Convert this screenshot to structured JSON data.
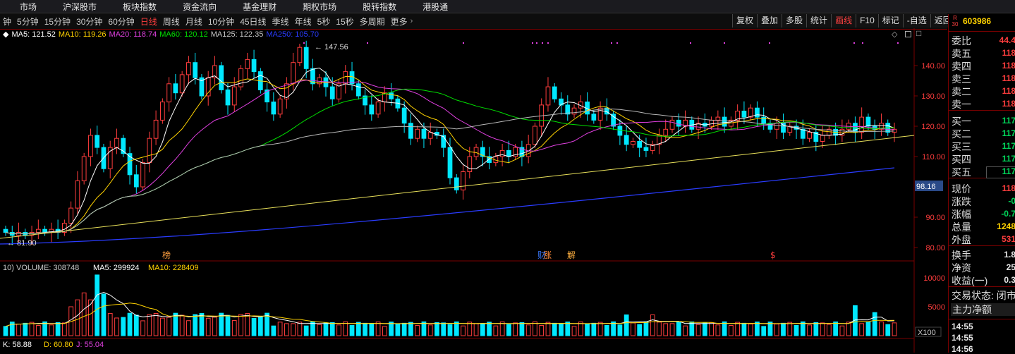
{
  "topbar": [
    "市场",
    "沪深股市",
    "板块指数",
    "资金流向",
    "基金理财",
    "期权市场",
    "股转指数",
    "港股通"
  ],
  "periods": [
    {
      "label": "钟",
      "active": false
    },
    {
      "label": "5分钟",
      "active": false
    },
    {
      "label": "15分钟",
      "active": false
    },
    {
      "label": "30分钟",
      "active": false
    },
    {
      "label": "60分钟",
      "active": false
    },
    {
      "label": "日线",
      "active": true
    },
    {
      "label": "周线",
      "active": false
    },
    {
      "label": "月线",
      "active": false
    },
    {
      "label": "10分钟",
      "active": false
    },
    {
      "label": "45日线",
      "active": false
    },
    {
      "label": "季线",
      "active": false
    },
    {
      "label": "年线",
      "active": false
    },
    {
      "label": "5秒",
      "active": false
    },
    {
      "label": "15秒",
      "active": false
    },
    {
      "label": "多周期",
      "active": false
    },
    {
      "label": "更多",
      "active": false
    }
  ],
  "period_more_icon": "chevron-right-icon",
  "tools": [
    {
      "label": "复权",
      "active": false
    },
    {
      "label": "叠加",
      "active": false
    },
    {
      "label": "多股",
      "active": false
    },
    {
      "label": "统计",
      "active": false
    },
    {
      "label": "画线",
      "active": true
    },
    {
      "label": "F10",
      "active": false
    },
    {
      "label": "标记",
      "active": false
    },
    {
      "label": "-自选",
      "active": false
    },
    {
      "label": "返回",
      "active": false
    }
  ],
  "ma_legend": [
    {
      "text": "MA5: 121.52",
      "color": "#ffffff"
    },
    {
      "text": "MA10: 119.26",
      "color": "#ffd200"
    },
    {
      "text": "MA20: 118.74",
      "color": "#e040e0"
    },
    {
      "text": "MA60: 120.12",
      "color": "#00e000"
    },
    {
      "text": "MA125: 122.35",
      "color": "#c8c8c8"
    },
    {
      "text": "MA250: 105.70",
      "color": "#2a3cff"
    }
  ],
  "vol_legend": [
    {
      "text": "10) VOLUME: 308748",
      "color": "#c8c8c8"
    },
    {
      "text": "MA5: 299924",
      "color": "#ffffff"
    },
    {
      "text": "MA10: 228409",
      "color": "#ffd200"
    }
  ],
  "ind_legend": [
    {
      "text": "K: 58.88",
      "color": "#ffffff"
    },
    {
      "text": "D: 60.80",
      "color": "#ffd200"
    },
    {
      "text": "J: 55.04",
      "color": "#e040e0"
    }
  ],
  "chart_data": {
    "type": "candlestick",
    "price_axis": {
      "ticks": [
        "140.00",
        "130.00",
        "120.00",
        "110.00",
        "90.00",
        "80.00"
      ],
      "range": [
        78,
        149
      ]
    },
    "current_price_tag": "98.16",
    "high_label": "147.56",
    "low_label": "81.90",
    "volume_axis": {
      "ticks": [
        "10000",
        "5000"
      ],
      "unit": "X100"
    },
    "event_markers": [
      "榜",
      "财",
      "涨",
      "解",
      "$"
    ],
    "candles_approx": [
      {
        "o": 86,
        "c": 85
      },
      {
        "o": 85,
        "c": 84
      },
      {
        "o": 84,
        "c": 85
      },
      {
        "o": 85,
        "c": 84
      },
      {
        "o": 84,
        "c": 85
      },
      {
        "o": 85,
        "c": 86
      },
      {
        "o": 86,
        "c": 85
      },
      {
        "o": 85,
        "c": 86
      },
      {
        "o": 86,
        "c": 85
      },
      {
        "o": 85,
        "c": 88
      },
      {
        "o": 88,
        "c": 93
      },
      {
        "o": 93,
        "c": 102
      },
      {
        "o": 102,
        "c": 110
      },
      {
        "o": 110,
        "c": 117
      },
      {
        "o": 117,
        "c": 113
      },
      {
        "o": 113,
        "c": 106
      },
      {
        "o": 106,
        "c": 113
      },
      {
        "o": 113,
        "c": 116
      },
      {
        "o": 116,
        "c": 111
      },
      {
        "o": 111,
        "c": 104
      },
      {
        "o": 104,
        "c": 100
      },
      {
        "o": 100,
        "c": 108
      },
      {
        "o": 108,
        "c": 116
      },
      {
        "o": 116,
        "c": 122
      },
      {
        "o": 122,
        "c": 128
      },
      {
        "o": 128,
        "c": 134
      },
      {
        "o": 134,
        "c": 131
      },
      {
        "o": 131,
        "c": 137
      },
      {
        "o": 137,
        "c": 141
      },
      {
        "o": 141,
        "c": 136
      },
      {
        "o": 136,
        "c": 130
      },
      {
        "o": 130,
        "c": 136
      },
      {
        "o": 136,
        "c": 140
      },
      {
        "o": 140,
        "c": 132
      },
      {
        "o": 132,
        "c": 127
      },
      {
        "o": 127,
        "c": 133
      },
      {
        "o": 133,
        "c": 139
      },
      {
        "o": 139,
        "c": 142
      },
      {
        "o": 142,
        "c": 138
      },
      {
        "o": 138,
        "c": 132
      },
      {
        "o": 132,
        "c": 128
      },
      {
        "o": 128,
        "c": 124
      },
      {
        "o": 124,
        "c": 129
      },
      {
        "o": 129,
        "c": 134
      },
      {
        "o": 134,
        "c": 141
      },
      {
        "o": 141,
        "c": 146
      },
      {
        "o": 146,
        "c": 139
      },
      {
        "o": 139,
        "c": 134
      },
      {
        "o": 134,
        "c": 136
      },
      {
        "o": 136,
        "c": 133
      },
      {
        "o": 133,
        "c": 129
      },
      {
        "o": 129,
        "c": 134
      },
      {
        "o": 134,
        "c": 138
      },
      {
        "o": 138,
        "c": 134
      },
      {
        "o": 134,
        "c": 130
      },
      {
        "o": 130,
        "c": 127
      },
      {
        "o": 127,
        "c": 124
      },
      {
        "o": 124,
        "c": 128
      },
      {
        "o": 128,
        "c": 131
      },
      {
        "o": 131,
        "c": 129
      },
      {
        "o": 129,
        "c": 126
      },
      {
        "o": 126,
        "c": 121
      },
      {
        "o": 121,
        "c": 116
      },
      {
        "o": 116,
        "c": 119
      },
      {
        "o": 119,
        "c": 116
      },
      {
        "o": 116,
        "c": 118
      },
      {
        "o": 118,
        "c": 117
      },
      {
        "o": 117,
        "c": 113
      },
      {
        "o": 113,
        "c": 103
      },
      {
        "o": 103,
        "c": 99
      },
      {
        "o": 99,
        "c": 105
      },
      {
        "o": 105,
        "c": 110
      },
      {
        "o": 110,
        "c": 113
      },
      {
        "o": 113,
        "c": 110
      },
      {
        "o": 110,
        "c": 108
      },
      {
        "o": 108,
        "c": 110
      },
      {
        "o": 110,
        "c": 112
      },
      {
        "o": 112,
        "c": 110
      },
      {
        "o": 110,
        "c": 113
      },
      {
        "o": 113,
        "c": 110
      },
      {
        "o": 110,
        "c": 114
      },
      {
        "o": 114,
        "c": 120
      },
      {
        "o": 120,
        "c": 127
      },
      {
        "o": 127,
        "c": 133
      },
      {
        "o": 133,
        "c": 129
      },
      {
        "o": 129,
        "c": 127
      },
      {
        "o": 127,
        "c": 124
      },
      {
        "o": 124,
        "c": 126
      },
      {
        "o": 126,
        "c": 128
      },
      {
        "o": 128,
        "c": 124
      },
      {
        "o": 124,
        "c": 122
      },
      {
        "o": 122,
        "c": 126
      },
      {
        "o": 126,
        "c": 124
      },
      {
        "o": 124,
        "c": 120
      },
      {
        "o": 120,
        "c": 117
      },
      {
        "o": 117,
        "c": 114
      },
      {
        "o": 114,
        "c": 115
      },
      {
        "o": 115,
        "c": 113
      },
      {
        "o": 113,
        "c": 112
      },
      {
        "o": 112,
        "c": 114
      },
      {
        "o": 114,
        "c": 117
      },
      {
        "o": 117,
        "c": 119
      },
      {
        "o": 119,
        "c": 122
      },
      {
        "o": 122,
        "c": 120
      },
      {
        "o": 120,
        "c": 122
      },
      {
        "o": 122,
        "c": 119
      },
      {
        "o": 119,
        "c": 121
      },
      {
        "o": 121,
        "c": 120
      },
      {
        "o": 120,
        "c": 122
      },
      {
        "o": 122,
        "c": 123
      },
      {
        "o": 123,
        "c": 120
      },
      {
        "o": 120,
        "c": 122
      },
      {
        "o": 122,
        "c": 125
      },
      {
        "o": 125,
        "c": 123
      },
      {
        "o": 123,
        "c": 126
      },
      {
        "o": 126,
        "c": 123
      },
      {
        "o": 123,
        "c": 121
      },
      {
        "o": 121,
        "c": 119
      },
      {
        "o": 119,
        "c": 121
      },
      {
        "o": 121,
        "c": 118
      },
      {
        "o": 118,
        "c": 120
      },
      {
        "o": 120,
        "c": 119
      },
      {
        "o": 119,
        "c": 116
      },
      {
        "o": 116,
        "c": 118
      },
      {
        "o": 118,
        "c": 115
      },
      {
        "o": 115,
        "c": 117
      },
      {
        "o": 117,
        "c": 119
      },
      {
        "o": 119,
        "c": 117
      },
      {
        "o": 117,
        "c": 119
      },
      {
        "o": 119,
        "c": 121
      },
      {
        "o": 121,
        "c": 118
      },
      {
        "o": 118,
        "c": 123
      },
      {
        "o": 123,
        "c": 120
      },
      {
        "o": 120,
        "c": 119
      },
      {
        "o": 119,
        "c": 121
      },
      {
        "o": 121,
        "c": 118
      },
      {
        "o": 118,
        "c": 119
      }
    ]
  },
  "quote": {
    "badge": "R\n30",
    "code": "603986",
    "rows": [
      {
        "label": "委比",
        "value": "44.4",
        "color": "red"
      },
      {
        "label": "卖五",
        "value": "118",
        "color": "red"
      },
      {
        "label": "卖四",
        "value": "118",
        "color": "red"
      },
      {
        "label": "卖三",
        "value": "118",
        "color": "red"
      },
      {
        "label": "卖二",
        "value": "118",
        "color": "red"
      },
      {
        "label": "卖一",
        "value": "118",
        "color": "red"
      },
      {
        "label": "买一",
        "value": "117",
        "color": "green"
      },
      {
        "label": "买二",
        "value": "117",
        "color": "green"
      },
      {
        "label": "买三",
        "value": "117",
        "color": "green"
      },
      {
        "label": "买四",
        "value": "117",
        "color": "green"
      },
      {
        "label": "买五",
        "value": "117",
        "color": "green"
      },
      {
        "label": "现价",
        "value": "118",
        "color": "red"
      },
      {
        "label": "涨跌",
        "value": "-0",
        "color": "green"
      },
      {
        "label": "涨幅",
        "value": "-0.7",
        "color": "green"
      },
      {
        "label": "总量",
        "value": "1248",
        "color": "yellow"
      },
      {
        "label": "外盘",
        "value": "531",
        "color": "red"
      },
      {
        "label": "换手",
        "value": "1.8",
        "color": "white"
      },
      {
        "label": "净资",
        "value": "25",
        "color": "white"
      },
      {
        "label": "收益(一)",
        "value": "0.3",
        "color": "white"
      }
    ],
    "trade_status": "交易状态: 闭市",
    "main_net": "主力净额",
    "ticks": [
      "14:55",
      "14:55",
      "14:56"
    ]
  }
}
